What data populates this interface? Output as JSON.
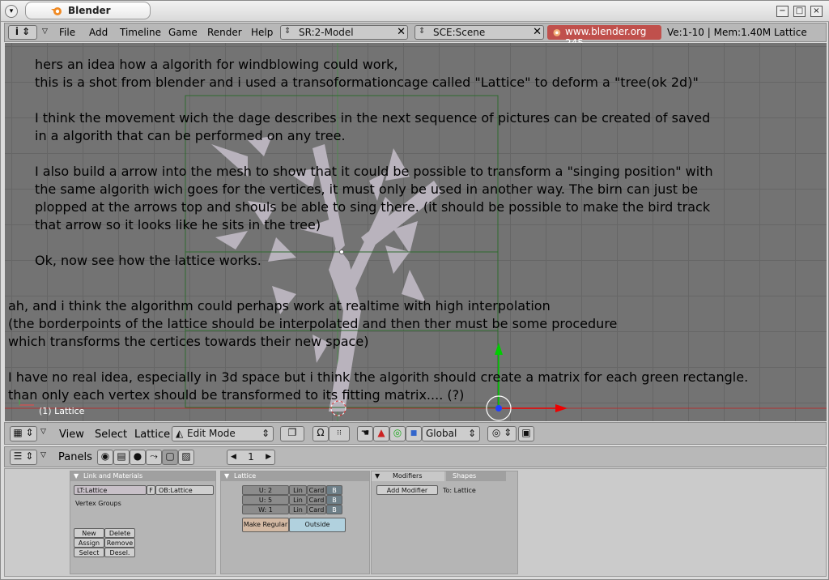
{
  "window": {
    "title": "Blender",
    "buttons": {
      "minimize": "−",
      "maximize": "□",
      "close": "×"
    }
  },
  "topbar": {
    "info_icon": "i",
    "menus": [
      "File",
      "Add",
      "Timeline",
      "Game",
      "Render",
      "Help"
    ],
    "screen_selector": "SR:2-Model",
    "scene_selector": "SCE:Scene",
    "url": "www.blender.org 245",
    "stats": "Ve:1-10 | Mem:1.40M Lattice"
  },
  "viewport": {
    "lines": [
      "hers an idea how a algorith for windblowing could work,",
      "this is a shot from blender and i used a transoformationcage called \"Lattice\" to deform a \"tree(ok 2d)\"",
      "I think the movement wich the dage describes in the next sequence of pictures can be created of saved",
      "in a algorith that can be performed on any tree.",
      "I also build a arrow into the mesh to show that it could be possible to transform a \"singing position\" with",
      "the same algorith wich goes for the vertices, it must only be used in another way. The birn can just be",
      "plopped at the arrows top and shouls be able to sing there. (it should be possible to make the bird track",
      "that arrow so it looks like he sits in the tree)",
      "Ok, now see how the lattice works.",
      "ah, and i think the algorithm could perhaps work at realtime with high interpolation",
      "(the borderpoints of the lattice should be interpolated and then ther must be some procedure",
      "which transforms the certices towards their new space)",
      "I have no real idea, especially in 3d space but i think the algorith should create a matrix for each green rectangle.",
      "than only each vertex should be transformed to its fitting matrix.... (?)"
    ],
    "object_label": "(1) Lattice"
  },
  "view_header": {
    "view": "View",
    "select": "Select",
    "lattice": "Lattice",
    "mode": "Edit Mode",
    "orientation": "Global"
  },
  "buttons_header": {
    "panels": "Panels",
    "frame": "1"
  },
  "link_panel": {
    "title": "Link and Materials",
    "lt": "LT:Lattice",
    "f": "F",
    "ob": "OB:Lattice",
    "vgroups": "Vertex Groups",
    "buttons": [
      "New",
      "Delete",
      "Assign",
      "Remove",
      "Select",
      "Desel."
    ]
  },
  "lattice_panel": {
    "title": "Lattice",
    "rows": [
      {
        "label": "U: 2"
      },
      {
        "label": "U: 5"
      },
      {
        "label": "W: 1"
      }
    ],
    "lin": "Lin",
    "card": "Card",
    "b": "B",
    "make_regular": "Make Regular",
    "outside": "Outside"
  },
  "modifiers_panel": {
    "tab_modifiers": "Modifiers",
    "tab_shapes": "Shapes",
    "add_modifier": "Add Modifier",
    "to": "To: Lattice"
  }
}
